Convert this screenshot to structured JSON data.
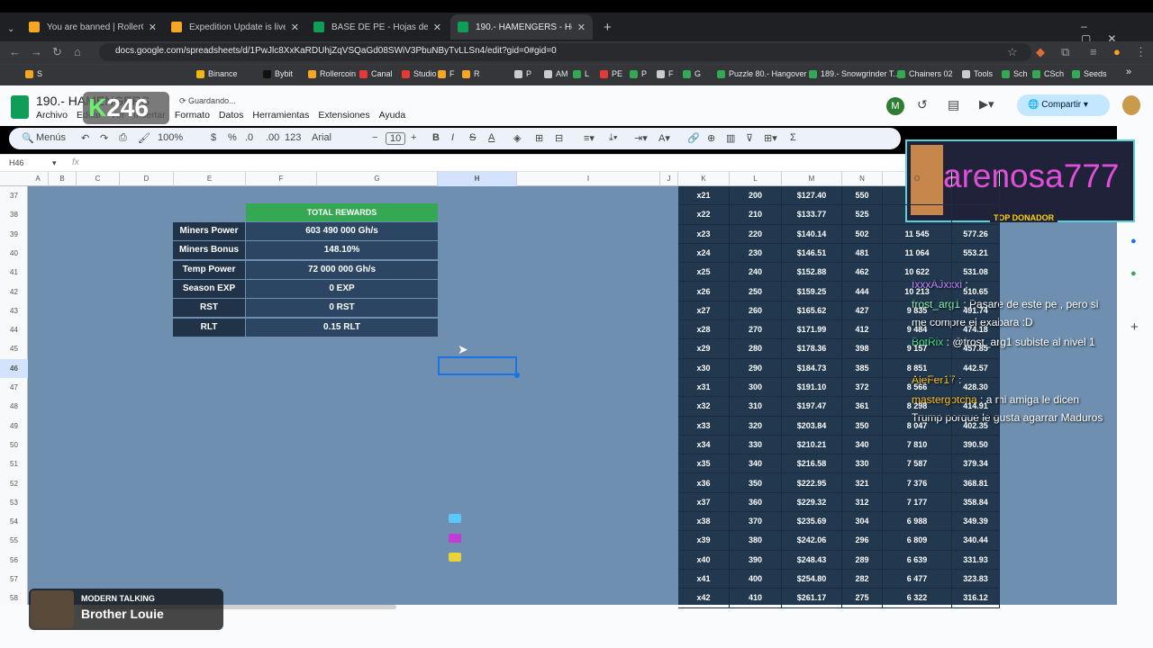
{
  "tabs": [
    {
      "title": "You are banned | RollerCoin.com",
      "color": "#f5a623"
    },
    {
      "title": "Expedition Update is live + Adv",
      "color": "#f5a623"
    },
    {
      "title": "BASE DE PE - Hojas de cálculo d",
      "color": "#0f9d58"
    },
    {
      "title": "190.- HAMENGERS - Hojas de c",
      "color": "#0f9d58"
    }
  ],
  "url": "docs.google.com/spreadsheets/d/1PwJlc8XxKaRDUhjZqVSQaGd08SWiV3PbuNByTvLLSn4/edit?gid=0#gid=0",
  "bookmarks": [
    "S",
    "Binance",
    "Bybit",
    "Rollercoin",
    "Canal",
    "Studio",
    "F",
    "R",
    "P",
    "AM",
    "L",
    "PE",
    "P",
    "F",
    "G",
    "Puzzle 80.- Hangover",
    "189.- Snowgrinder T...",
    "Chainers 02",
    "Tools",
    "Sch",
    "CSch",
    "Seeds"
  ],
  "doc": {
    "title": "190.- HAMENGERS",
    "saving": "Guardando...",
    "share": "Compartir",
    "avatar": "M"
  },
  "menu": [
    "Archivo",
    "Editar",
    "Ver",
    "Insertar",
    "Formato",
    "Datos",
    "Herramientas",
    "Extensiones",
    "Ayuda"
  ],
  "toolbar": {
    "search": "Menús",
    "zoom": "100%",
    "currency": "$",
    "percent": "%",
    "dec_minus": ".0",
    "dec_plus": ".00",
    "fmt": "123",
    "font": "Arial",
    "size": "10"
  },
  "cellref": "H46",
  "fx": "fx",
  "columns": [
    "A",
    "B",
    "C",
    "D",
    "E",
    "F",
    "G",
    "H",
    "I",
    "J",
    "K",
    "L",
    "M",
    "N",
    "O",
    "P"
  ],
  "rows": [
    "37",
    "38",
    "39",
    "40",
    "41",
    "42",
    "43",
    "44",
    "45",
    "46",
    "47",
    "48",
    "49",
    "50",
    "51",
    "52",
    "53",
    "54",
    "55",
    "56",
    "57",
    "58"
  ],
  "rewards": {
    "title": "TOTAL REWARDS",
    "rows": [
      {
        "label": "Miners Power",
        "value": "603 490 000 Gh/s"
      },
      {
        "label": "Miners Bonus",
        "value": "148.10%"
      },
      {
        "label": "Temp Power",
        "value": "72 000 000 Gh/s"
      },
      {
        "label": "Season EXP",
        "value": "0 EXP"
      },
      {
        "label": "RST",
        "value": "0 RST"
      },
      {
        "label": "RLT",
        "value": "0.15 RLT"
      }
    ]
  },
  "data_rows": [
    [
      "x21",
      "200",
      "$127.40",
      "550",
      "",
      ""
    ],
    [
      "x22",
      "210",
      "$133.77",
      "525",
      "",
      ""
    ],
    [
      "x23",
      "220",
      "$140.14",
      "502",
      "11 545",
      "577.26"
    ],
    [
      "x24",
      "230",
      "$146.51",
      "481",
      "11 064",
      "553.21"
    ],
    [
      "x25",
      "240",
      "$152.88",
      "462",
      "10 622",
      "531.08"
    ],
    [
      "x26",
      "250",
      "$159.25",
      "444",
      "10 213",
      "510.65"
    ],
    [
      "x27",
      "260",
      "$165.62",
      "427",
      "9 835",
      "491.74"
    ],
    [
      "x28",
      "270",
      "$171.99",
      "412",
      "9 484",
      "474.18"
    ],
    [
      "x29",
      "280",
      "$178.36",
      "398",
      "9 157",
      "457.85"
    ],
    [
      "x30",
      "290",
      "$184.73",
      "385",
      "8 851",
      "442.57"
    ],
    [
      "x31",
      "300",
      "$191.10",
      "372",
      "8 566",
      "428.30"
    ],
    [
      "x32",
      "310",
      "$197.47",
      "361",
      "8 298",
      "414.91"
    ],
    [
      "x33",
      "320",
      "$203.84",
      "350",
      "8 047",
      "402.35"
    ],
    [
      "x34",
      "330",
      "$210.21",
      "340",
      "7 810",
      "390.50"
    ],
    [
      "x35",
      "340",
      "$216.58",
      "330",
      "7 587",
      "379.34"
    ],
    [
      "x36",
      "350",
      "$222.95",
      "321",
      "7 376",
      "368.81"
    ],
    [
      "x37",
      "360",
      "$229.32",
      "312",
      "7 177",
      "358.84"
    ],
    [
      "x38",
      "370",
      "$235.69",
      "304",
      "6 988",
      "349.39"
    ],
    [
      "x39",
      "380",
      "$242.06",
      "296",
      "6 809",
      "340.44"
    ],
    [
      "x40",
      "390",
      "$248.43",
      "289",
      "6 639",
      "331.93"
    ],
    [
      "x41",
      "400",
      "$254.80",
      "282",
      "6 477",
      "323.83"
    ],
    [
      "x42",
      "410",
      "$261.17",
      "275",
      "6 322",
      "316.12"
    ]
  ],
  "overlay": {
    "name": "arenosa777",
    "badge": "TOP DONADOR",
    "counter": "246"
  },
  "chat": [
    {
      "user": "IxxxAJxxxl",
      "text": ""
    },
    {
      "user": "frost_arg1",
      "text": "Pasare de este pe , pero si me compre el exabara :D"
    },
    {
      "user": "BotRix",
      "text": "@frost_arg1 subiste al nivel 1"
    },
    {
      "user": "AleFer17",
      "text": ""
    },
    {
      "user": "mastergotcha",
      "text": "a mi amiga le dicen Trump porque le gusta agarrar Maduros"
    }
  ],
  "music": {
    "artist": "MODERN TALKING",
    "song": "Brother Louie"
  },
  "colors": {
    "sheet_bg": "#6e8faf",
    "header_green": "#34a853",
    "dark_cell": "#203349",
    "value_cell": "#2b4563"
  }
}
